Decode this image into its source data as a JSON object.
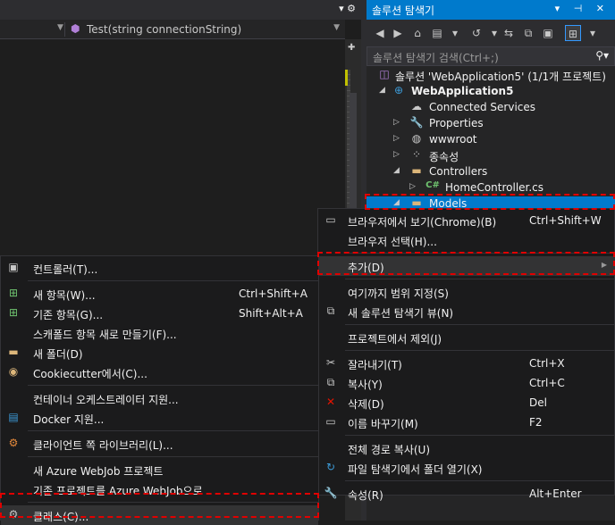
{
  "editor": {
    "method_signature": "Test(string connectionString)"
  },
  "solution_explorer": {
    "title": "솔루션 탐색기",
    "search_placeholder": "솔루션 탐색기 검색(Ctrl+;)",
    "tree": [
      {
        "label": "솔루션 'WebApplication5' (1/1개 프로젝트)",
        "icon": "solution-icon"
      },
      {
        "label": "WebApplication5",
        "icon": "web-project-icon"
      },
      {
        "label": "Connected Services",
        "icon": "cloud-icon"
      },
      {
        "label": "Properties",
        "icon": "wrench-icon"
      },
      {
        "label": "wwwroot",
        "icon": "globe-icon"
      },
      {
        "label": "종속성",
        "icon": "dependencies-icon"
      },
      {
        "label": "Controllers",
        "icon": "folder-icon"
      },
      {
        "label": "HomeController.cs",
        "icon": "csharp-file-icon"
      },
      {
        "label": "Models",
        "icon": "folder-icon"
      }
    ]
  },
  "context_menu": {
    "items": [
      {
        "label": "브라우저에서 보기(Chrome)(B)",
        "shortcut": "Ctrl+Shift+W"
      },
      {
        "label": "브라우저 선택(H)...",
        "shortcut": ""
      },
      {
        "label": "추가(D)",
        "shortcut": ""
      },
      {
        "label": "여기까지 범위 지정(S)",
        "shortcut": ""
      },
      {
        "label": "새 솔루션 탐색기 뷰(N)",
        "shortcut": ""
      },
      {
        "label": "프로젝트에서 제외(J)",
        "shortcut": ""
      },
      {
        "label": "잘라내기(T)",
        "shortcut": "Ctrl+X"
      },
      {
        "label": "복사(Y)",
        "shortcut": "Ctrl+C"
      },
      {
        "label": "삭제(D)",
        "shortcut": "Del"
      },
      {
        "label": "이름 바꾸기(M)",
        "shortcut": "F2"
      },
      {
        "label": "전체 경로 복사(U)",
        "shortcut": ""
      },
      {
        "label": "파일 탐색기에서 폴더 열기(X)",
        "shortcut": ""
      },
      {
        "label": "속성(R)",
        "shortcut": "Alt+Enter"
      }
    ]
  },
  "add_submenu": {
    "items": [
      {
        "label": "컨트롤러(T)...",
        "shortcut": ""
      },
      {
        "label": "새 항목(W)...",
        "shortcut": "Ctrl+Shift+A"
      },
      {
        "label": "기존 항목(G)...",
        "shortcut": "Shift+Alt+A"
      },
      {
        "label": "스캐폴드 항목 새로 만들기(F)...",
        "shortcut": ""
      },
      {
        "label": "새 폴더(D)",
        "shortcut": ""
      },
      {
        "label": "Cookiecutter에서(C)...",
        "shortcut": ""
      },
      {
        "label": "컨테이너 오케스트레이터 지원...",
        "shortcut": ""
      },
      {
        "label": "Docker 지원...",
        "shortcut": ""
      },
      {
        "label": "클라이언트 쪽 라이브러리(L)...",
        "shortcut": ""
      },
      {
        "label": "새 Azure WebJob 프로젝트",
        "shortcut": ""
      },
      {
        "label": "기존 프로젝트를 Azure WebJob으로",
        "shortcut": ""
      },
      {
        "label": "클래스(C)...",
        "shortcut": ""
      }
    ]
  },
  "colors": {
    "accent": "#007acc",
    "highlight_box": "#e00000"
  }
}
